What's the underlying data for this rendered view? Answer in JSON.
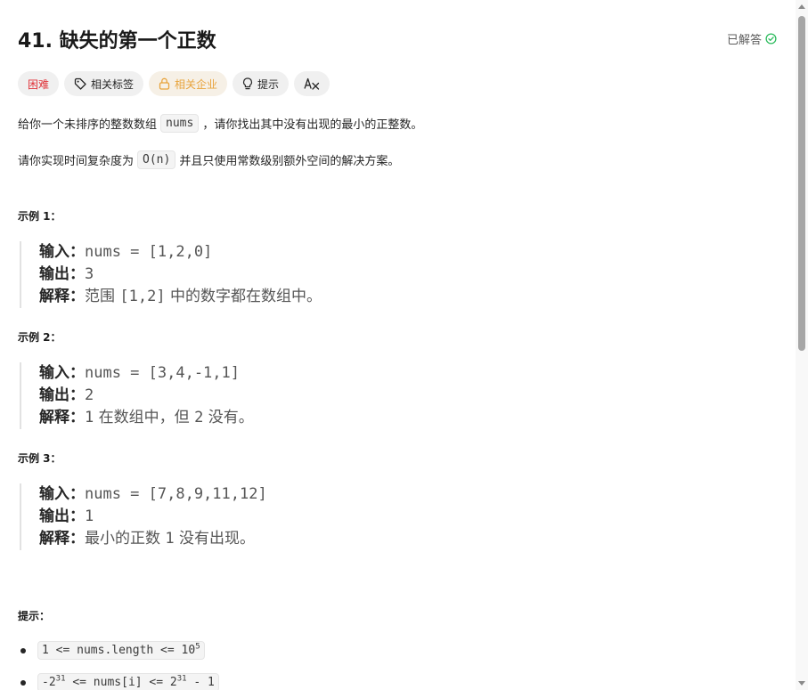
{
  "problem": {
    "title": "41. 缺失的第一个正数",
    "solved_label": "已解答"
  },
  "tags": {
    "difficulty": "困难",
    "related_tags": "相关标签",
    "related_companies": "相关企业",
    "hint": "提示"
  },
  "description": {
    "p1_before": "给你一个未排序的整数数组",
    "p1_code": "nums",
    "p1_after": "，请你找出其中没有出现的最小的正整数。",
    "p2_before": "请你实现时间复杂度为",
    "p2_code": "O(n)",
    "p2_after": "并且只使用常数级别额外空间的解决方案。"
  },
  "examples": [
    {
      "title": "示例 1：",
      "input_label": "输入：",
      "input": "nums = [1,2,0]",
      "output_label": "输出：",
      "output": "3",
      "explain_label": "解释：",
      "explain_a": "范围 ",
      "explain_code": "[1,2]",
      "explain_b": " 中的数字都在数组中。"
    },
    {
      "title": "示例 2：",
      "input_label": "输入：",
      "input": "nums = [3,4,-1,1]",
      "output_label": "输出：",
      "output": "2",
      "explain_label": "解释：",
      "explain_a": "1",
      "explain_b": " 在数组中，但 ",
      "explain_c": "2",
      "explain_d": " 没有。"
    },
    {
      "title": "示例 3：",
      "input_label": "输入：",
      "input": "nums = [7,8,9,11,12]",
      "output_label": "输出：",
      "output": "1",
      "explain_label": "解释：",
      "explain_a": "最小的正数 ",
      "explain_code": "1",
      "explain_b": " 没有出现。"
    }
  ],
  "hints": {
    "title": "提示：",
    "c1_text": "1 <= nums.length <= 10",
    "c1_sup": "5",
    "c2_a": "-2",
    "c2_sup1": "31",
    "c2_b": " <= nums[i] <= 2",
    "c2_sup2": "31",
    "c2_c": " - 1"
  },
  "colors": {
    "hard": "#e0343a",
    "company": "#e8a33b",
    "solved_check": "#2cbb5d"
  }
}
